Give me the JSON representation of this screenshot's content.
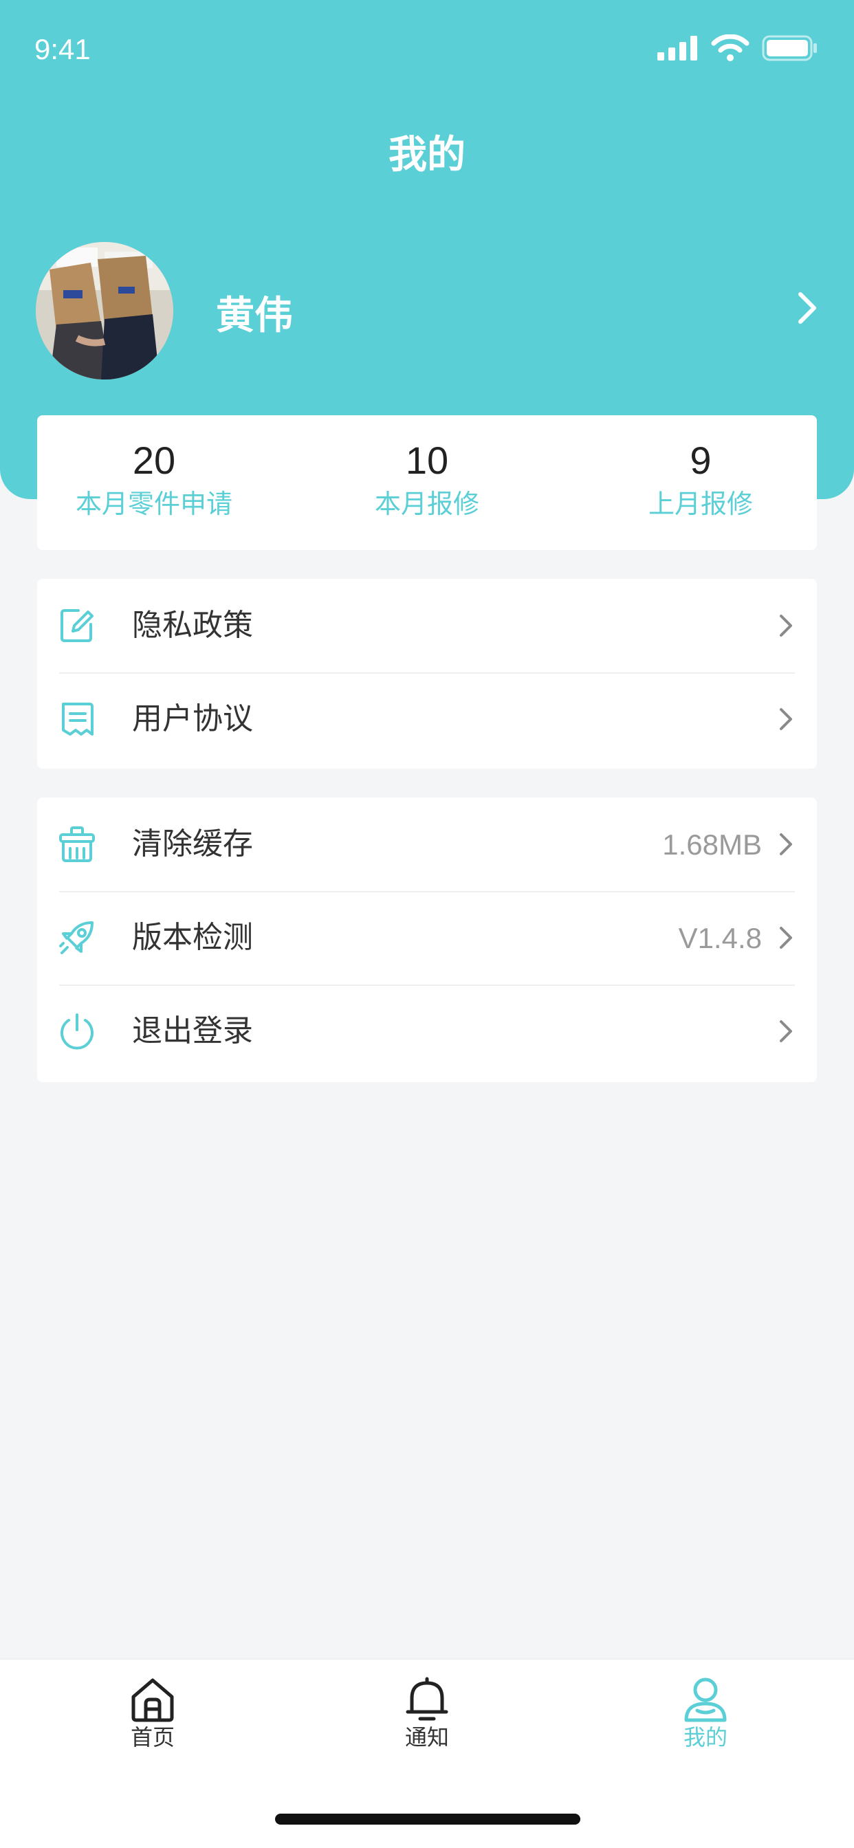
{
  "status_bar": {
    "time": "9:41"
  },
  "header": {
    "title": "我的"
  },
  "profile": {
    "name": "黄伟"
  },
  "stats": [
    {
      "value": "20",
      "label": "本月零件申请"
    },
    {
      "value": "10",
      "label": "本月报修"
    },
    {
      "value": "9",
      "label": "上月报修"
    }
  ],
  "menu_group_1": [
    {
      "label": "隐私政策",
      "icon": "edit-icon"
    },
    {
      "label": "用户协议",
      "icon": "document-icon"
    }
  ],
  "menu_group_2": [
    {
      "label": "清除缓存",
      "value": "1.68MB",
      "icon": "broom-icon"
    },
    {
      "label": "版本检测",
      "value": "V1.4.8",
      "icon": "rocket-icon"
    },
    {
      "label": "退出登录",
      "icon": "power-icon"
    }
  ],
  "tabbar": {
    "tabs": [
      {
        "label": "首页",
        "icon": "home-icon",
        "active": false
      },
      {
        "label": "通知",
        "icon": "bell-icon",
        "active": false
      },
      {
        "label": "我的",
        "icon": "user-icon",
        "active": true
      }
    ]
  },
  "colors": {
    "accent": "#5bcfd6",
    "background": "#f4f5f7",
    "text": "#333333",
    "muted": "#9a9a9a"
  }
}
